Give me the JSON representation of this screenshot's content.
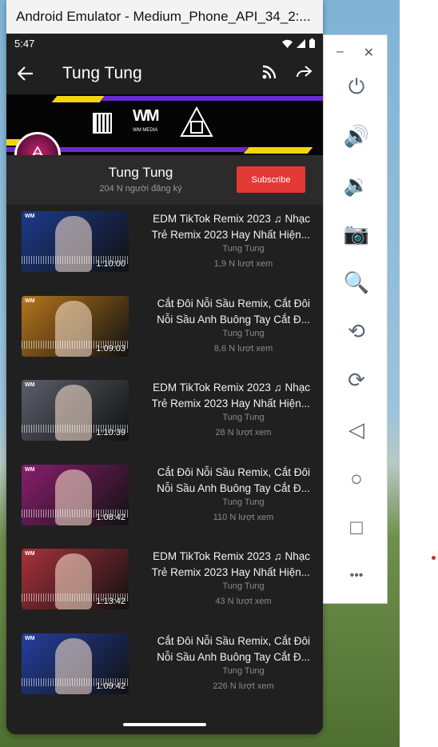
{
  "window": {
    "title": "Android Emulator - Medium_Phone_API_34_2:..."
  },
  "status_bar": {
    "time": "5:47"
  },
  "app_bar": {
    "title": "Tung Tung"
  },
  "channel": {
    "name": "Tung Tung",
    "subscribers": "204 N người đăng ký",
    "subscribe_label": "Subscribe",
    "banner_logo_text": "WM",
    "banner_logo_sub": "WM MEDIA"
  },
  "videos": [
    {
      "title": "EDM TikTok Remix 2023 ♫ Nhạc Trẻ Remix 2023 Hay Nhất Hiện...",
      "channel": "Tung Tung",
      "views": "1,9 N lượt xem",
      "duration": "1:10:00",
      "thumb_color": "#1b3a8a"
    },
    {
      "title": "Cắt Đôi Nỗi Sầu Remix, Cắt Đôi Nỗi Sầu Anh Buông Tay Cắt Đ...",
      "channel": "Tung Tung",
      "views": "8,6 N lượt xem",
      "duration": "1:09:03",
      "thumb_color": "#b5761c"
    },
    {
      "title": "EDM TikTok Remix 2023 ♫ Nhạc Trẻ Remix 2023 Hay Nhất Hiện...",
      "channel": "Tung Tung",
      "views": "28 N lượt xem",
      "duration": "1:10:39",
      "thumb_color": "#5a5f6a"
    },
    {
      "title": "Cắt Đôi Nỗi Sầu Remix, Cắt Đôi Nỗi Sầu Anh Buông Tay Cắt Đ...",
      "channel": "Tung Tung",
      "views": "110 N lượt xem",
      "duration": "1:08:42",
      "thumb_color": "#8a1e6e"
    },
    {
      "title": "EDM TikTok Remix 2023 ♫ Nhạc Trẻ Remix 2023 Hay Nhất Hiện...",
      "channel": "Tung Tung",
      "views": "43 N lượt xem",
      "duration": "1:13:42",
      "thumb_color": "#a8323a"
    },
    {
      "title": "Cắt Đôi Nỗi Sầu Remix, Cắt Đôi Nỗi Sầu Anh Buông Tay Cắt Đ...",
      "channel": "Tung Tung",
      "views": "226 N lượt xem",
      "duration": "1:09:42",
      "thumb_color": "#243f9e"
    }
  ],
  "toolbar": {
    "buttons": [
      {
        "name": "power-icon",
        "glyph": "⏻"
      },
      {
        "name": "volume-up-icon",
        "glyph": "🔊"
      },
      {
        "name": "volume-down-icon",
        "glyph": "🔉"
      },
      {
        "name": "camera-icon",
        "glyph": "📷"
      },
      {
        "name": "zoom-icon",
        "glyph": "🔍"
      },
      {
        "name": "rotate-left-icon",
        "glyph": "⟲"
      },
      {
        "name": "rotate-right-icon",
        "glyph": "⟳"
      },
      {
        "name": "back-icon",
        "glyph": "◁"
      },
      {
        "name": "home-icon",
        "glyph": "○"
      },
      {
        "name": "overview-icon",
        "glyph": "□"
      },
      {
        "name": "more-icon",
        "glyph": "•••"
      }
    ]
  }
}
